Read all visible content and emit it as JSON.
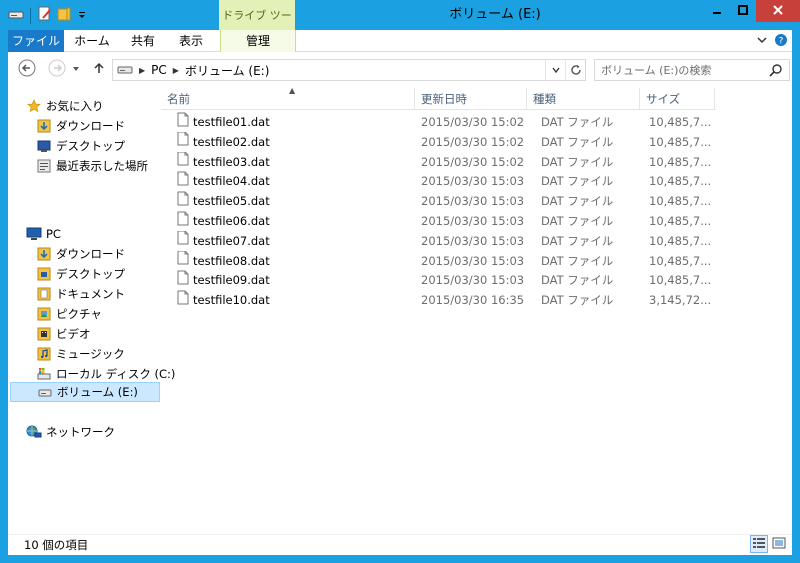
{
  "window": {
    "title": "ボリューム (E:)",
    "context_tab_title": "ドライブ ツール",
    "accent_color": "#1ba1e2"
  },
  "ribbon": {
    "tabs": [
      {
        "label": "ファイル"
      },
      {
        "label": "ホーム"
      },
      {
        "label": "共有"
      },
      {
        "label": "表示"
      },
      {
        "label": "管理"
      }
    ]
  },
  "address": {
    "crumbs": [
      "PC",
      "ボリューム (E:)"
    ]
  },
  "search": {
    "placeholder": "ボリューム (E:)の検索"
  },
  "nav": {
    "favorites_label": "お気に入り",
    "favorites": [
      {
        "label": "ダウンロード",
        "icon": "download-folder-icon"
      },
      {
        "label": "デスクトップ",
        "icon": "desktop-icon"
      },
      {
        "label": "最近表示した場所",
        "icon": "recent-places-icon"
      }
    ],
    "pc_label": "PC",
    "pc_items": [
      {
        "label": "ダウンロード",
        "icon": "download-folder-icon"
      },
      {
        "label": "デスクトップ",
        "icon": "desktop-folder-icon"
      },
      {
        "label": "ドキュメント",
        "icon": "documents-icon"
      },
      {
        "label": "ピクチャ",
        "icon": "pictures-icon"
      },
      {
        "label": "ビデオ",
        "icon": "videos-icon"
      },
      {
        "label": "ミュージック",
        "icon": "music-icon"
      },
      {
        "label": "ローカル ディスク (C:)",
        "icon": "local-disk-icon"
      },
      {
        "label": "ボリューム (E:)",
        "icon": "drive-icon",
        "selected": true
      }
    ],
    "network_label": "ネットワーク"
  },
  "columns": {
    "name": "名前",
    "date": "更新日時",
    "type": "種類",
    "size": "サイズ"
  },
  "files": [
    {
      "name": "testfile01.dat",
      "date": "2015/03/30 15:02",
      "type": "DAT ファイル",
      "size": "10,485,7..."
    },
    {
      "name": "testfile02.dat",
      "date": "2015/03/30 15:02",
      "type": "DAT ファイル",
      "size": "10,485,7..."
    },
    {
      "name": "testfile03.dat",
      "date": "2015/03/30 15:02",
      "type": "DAT ファイル",
      "size": "10,485,7..."
    },
    {
      "name": "testfile04.dat",
      "date": "2015/03/30 15:03",
      "type": "DAT ファイル",
      "size": "10,485,7..."
    },
    {
      "name": "testfile05.dat",
      "date": "2015/03/30 15:03",
      "type": "DAT ファイル",
      "size": "10,485,7..."
    },
    {
      "name": "testfile06.dat",
      "date": "2015/03/30 15:03",
      "type": "DAT ファイル",
      "size": "10,485,7..."
    },
    {
      "name": "testfile07.dat",
      "date": "2015/03/30 15:03",
      "type": "DAT ファイル",
      "size": "10,485,7..."
    },
    {
      "name": "testfile08.dat",
      "date": "2015/03/30 15:03",
      "type": "DAT ファイル",
      "size": "10,485,7..."
    },
    {
      "name": "testfile09.dat",
      "date": "2015/03/30 15:03",
      "type": "DAT ファイル",
      "size": "10,485,7..."
    },
    {
      "name": "testfile10.dat",
      "date": "2015/03/30 16:35",
      "type": "DAT ファイル",
      "size": "3,145,72..."
    }
  ],
  "status": {
    "item_count": "10 個の項目"
  }
}
